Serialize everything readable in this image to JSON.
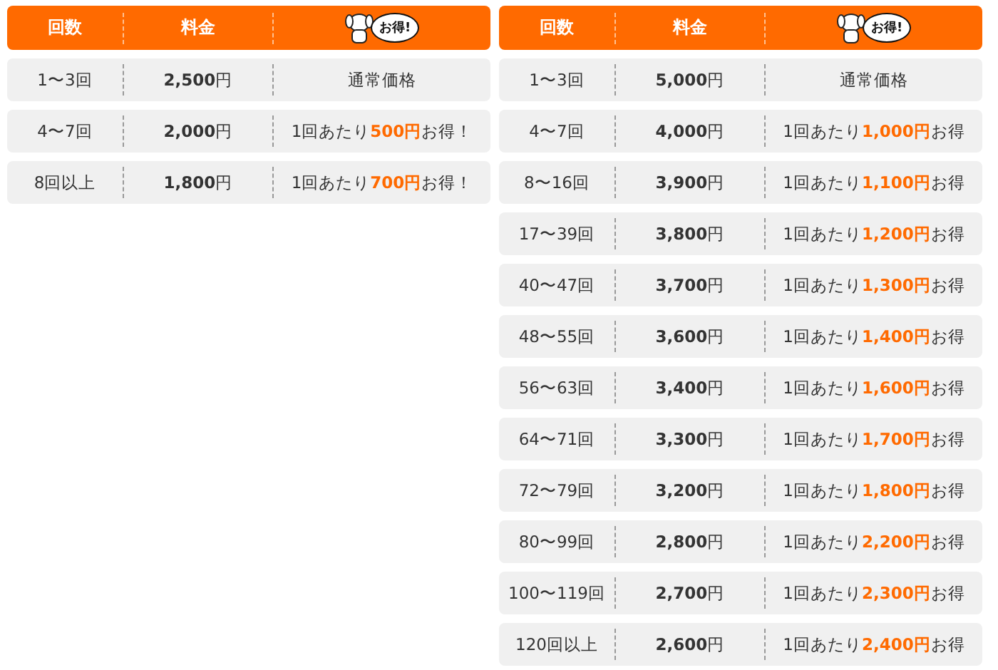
{
  "tables": [
    {
      "columns": [
        "回数",
        "料金"
      ],
      "badge": "お得!",
      "rows": [
        {
          "count": "1〜3回",
          "price": "**2,500**円",
          "benefit": "通常価格"
        },
        {
          "count": "4〜7回",
          "price": "**2,000**円",
          "benefit": "1回あたり**500円**お得！"
        },
        {
          "count": "8回以上",
          "price": "**1,800**円",
          "benefit": "1回あたり**700円**お得！"
        }
      ]
    },
    {
      "columns": [
        "回数",
        "料金"
      ],
      "badge": "お得!",
      "rows": [
        {
          "count": "1〜3回",
          "price": "**5,000**円",
          "benefit": "通常価格"
        },
        {
          "count": "4〜7回",
          "price": "**4,000**円",
          "benefit": "1回あたり**1,000円**お得"
        },
        {
          "count": "8〜16回",
          "price": "**3,900**円",
          "benefit": "1回あたり**1,100円**お得"
        },
        {
          "count": "17〜39回",
          "price": "**3,800**円",
          "benefit": "1回あたり**1,200円**お得"
        },
        {
          "count": "40〜47回",
          "price": "**3,700**円",
          "benefit": "1回あたり**1,300円**お得"
        },
        {
          "count": "48〜55回",
          "price": "**3,600**円",
          "benefit": "1回あたり**1,400円**お得"
        },
        {
          "count": "56〜63回",
          "price": "**3,400**円",
          "benefit": "1回あたり**1,600円**お得"
        },
        {
          "count": "64〜71回",
          "price": "**3,300**円",
          "benefit": "1回あたり**1,700円**お得"
        },
        {
          "count": "72〜79回",
          "price": "**3,200**円",
          "benefit": "1回あたり**1,800円**お得"
        },
        {
          "count": "80〜99回",
          "price": "**2,800**円",
          "benefit": "1回あたり**2,200円**お得"
        },
        {
          "count": "100〜119回",
          "price": "**2,700**円",
          "benefit": "1回あたり**2,300円**お得"
        },
        {
          "count": "120回以上",
          "price": "**2,600**円",
          "benefit": "1回あたり**2,400円**お得"
        }
      ]
    }
  ]
}
